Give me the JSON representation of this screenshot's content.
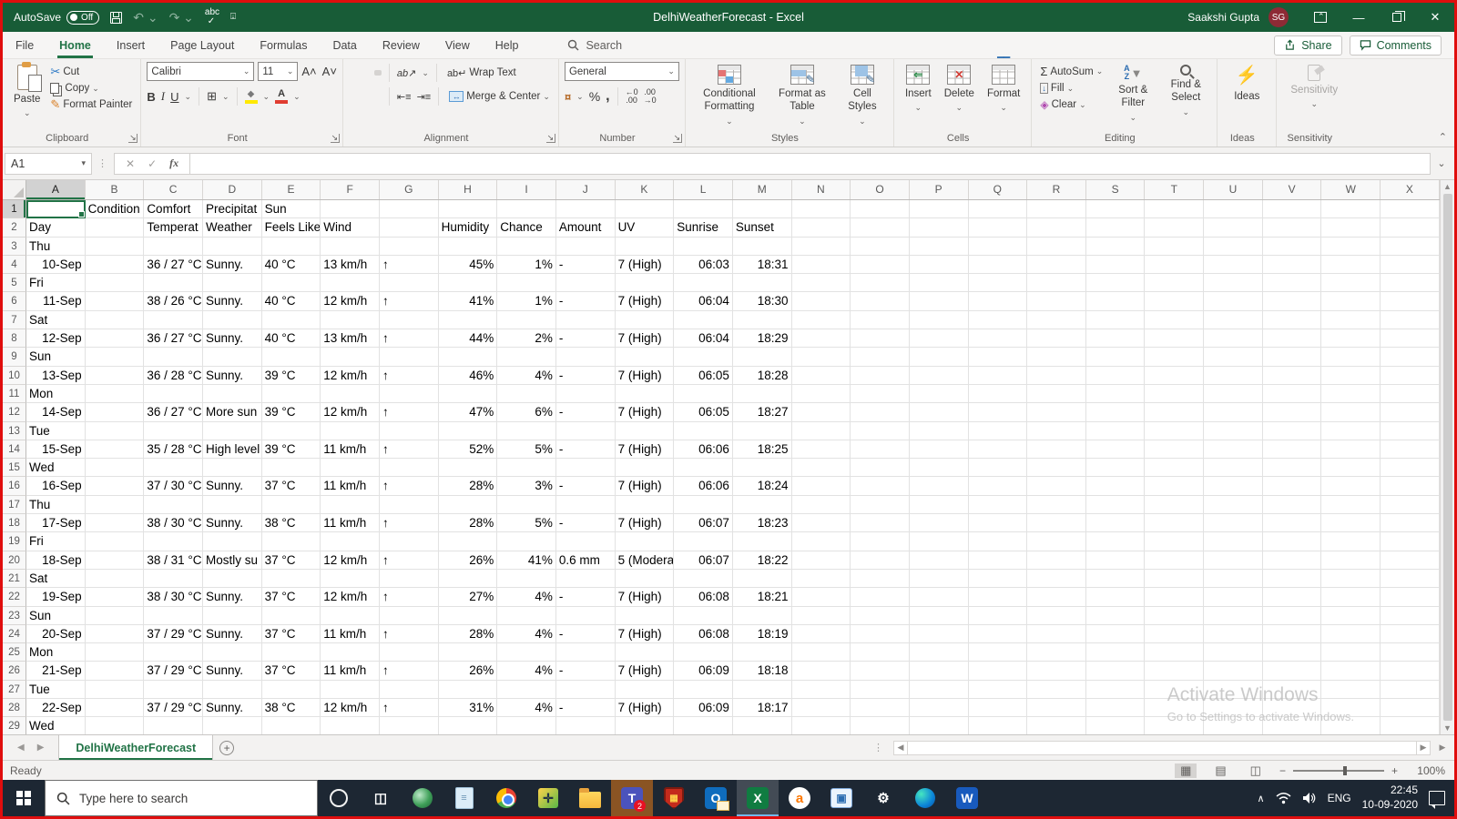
{
  "window": {
    "autosave_label": "AutoSave",
    "autosave_state": "Off",
    "title": "DelhiWeatherForecast  -  Excel",
    "user_name": "Saakshi Gupta",
    "user_initials": "SG"
  },
  "colors": {
    "title_green": "#185c37",
    "accent_green": "#217346",
    "screen_border_red": "#e00d0d",
    "taskbar_dark": "#1d2733",
    "teams_attention_orange": "#8a5423"
  },
  "ribbon_tabs": {
    "items": [
      {
        "label": "File",
        "active": false
      },
      {
        "label": "Home",
        "active": true
      },
      {
        "label": "Insert",
        "active": false
      },
      {
        "label": "Page Layout",
        "active": false
      },
      {
        "label": "Formulas",
        "active": false
      },
      {
        "label": "Data",
        "active": false
      },
      {
        "label": "Review",
        "active": false
      },
      {
        "label": "View",
        "active": false
      },
      {
        "label": "Help",
        "active": false
      }
    ],
    "search_label": "Search",
    "share_label": "Share",
    "comments_label": "Comments"
  },
  "ribbon": {
    "clipboard": {
      "label": "Clipboard",
      "paste": "Paste",
      "cut": "Cut",
      "copy": "Copy",
      "format_painter": "Format Painter"
    },
    "font": {
      "label": "Font",
      "font_name": "Calibri",
      "font_size": "11",
      "bold": "B",
      "italic": "I",
      "underline": "U"
    },
    "alignment": {
      "label": "Alignment",
      "wrap_text": "Wrap Text",
      "merge_center": "Merge & Center"
    },
    "number": {
      "label": "Number",
      "format": "General"
    },
    "styles": {
      "label": "Styles",
      "conditional": "Conditional Formatting",
      "format_table": "Format as Table",
      "cell_styles": "Cell Styles"
    },
    "cells": {
      "label": "Cells",
      "insert": "Insert",
      "delete": "Delete",
      "format": "Format"
    },
    "editing": {
      "label": "Editing",
      "autosum": "AutoSum",
      "fill": "Fill",
      "clear": "Clear",
      "sort_filter": "Sort & Filter",
      "find_select": "Find & Select"
    },
    "ideas": {
      "label": "Ideas",
      "button": "Ideas"
    },
    "sensitivity": {
      "label": "Sensitivity",
      "button": "Sensitivity"
    }
  },
  "formula_bar": {
    "name_box": "A1",
    "fx_label": "fx",
    "formula": ""
  },
  "grid": {
    "selected_cell": "A1",
    "selected_col": "A",
    "selected_row": 1,
    "columns": [
      "A",
      "B",
      "C",
      "D",
      "E",
      "F",
      "G",
      "H",
      "I",
      "J",
      "K",
      "L",
      "M",
      "N",
      "O",
      "P",
      "Q",
      "R",
      "S",
      "T",
      "U",
      "V",
      "W",
      "X"
    ],
    "rows": [
      {
        "n": 1,
        "cells": {
          "B": [
            "Condition"
          ],
          "C": [
            "Comfort"
          ],
          "D": [
            "Precipitat"
          ],
          "E": [
            "Sun"
          ]
        }
      },
      {
        "n": 2,
        "cells": {
          "A": [
            "Day"
          ],
          "C": [
            "Temperat"
          ],
          "D": [
            "Weather"
          ],
          "E": [
            "Feels Like"
          ],
          "F": [
            "Wind"
          ],
          "H": [
            "Humidity"
          ],
          "I": [
            "Chance"
          ],
          "J": [
            "Amount"
          ],
          "K": [
            "UV"
          ],
          "L": [
            "Sunrise"
          ],
          "M": [
            "Sunset"
          ]
        }
      },
      {
        "n": 3,
        "cells": {
          "A": [
            "Thu"
          ]
        }
      },
      {
        "n": 4,
        "cells": {
          "A": [
            "10-Sep",
            "r"
          ],
          "C": [
            "36 / 27 °C"
          ],
          "D": [
            "Sunny."
          ],
          "E": [
            "40 °C"
          ],
          "F": [
            "13 km/h"
          ],
          "G": [
            "↑"
          ],
          "H": [
            "45%",
            "r"
          ],
          "I": [
            "1%",
            "r"
          ],
          "J": [
            "-"
          ],
          "K": [
            "7 (High)"
          ],
          "L": [
            "06:03",
            "r"
          ],
          "M": [
            "18:31",
            "r"
          ]
        }
      },
      {
        "n": 5,
        "cells": {
          "A": [
            "Fri"
          ]
        }
      },
      {
        "n": 6,
        "cells": {
          "A": [
            "11-Sep",
            "r"
          ],
          "C": [
            "38 / 26 °C"
          ],
          "D": [
            "Sunny."
          ],
          "E": [
            "40 °C"
          ],
          "F": [
            "12 km/h"
          ],
          "G": [
            "↑"
          ],
          "H": [
            "41%",
            "r"
          ],
          "I": [
            "1%",
            "r"
          ],
          "J": [
            "-"
          ],
          "K": [
            "7 (High)"
          ],
          "L": [
            "06:04",
            "r"
          ],
          "M": [
            "18:30",
            "r"
          ]
        }
      },
      {
        "n": 7,
        "cells": {
          "A": [
            "Sat"
          ]
        }
      },
      {
        "n": 8,
        "cells": {
          "A": [
            "12-Sep",
            "r"
          ],
          "C": [
            "36 / 27 °C"
          ],
          "D": [
            "Sunny."
          ],
          "E": [
            "40 °C"
          ],
          "F": [
            "13 km/h"
          ],
          "G": [
            "↑"
          ],
          "H": [
            "44%",
            "r"
          ],
          "I": [
            "2%",
            "r"
          ],
          "J": [
            "-"
          ],
          "K": [
            "7 (High)"
          ],
          "L": [
            "06:04",
            "r"
          ],
          "M": [
            "18:29",
            "r"
          ]
        }
      },
      {
        "n": 9,
        "cells": {
          "A": [
            "Sun"
          ]
        }
      },
      {
        "n": 10,
        "cells": {
          "A": [
            "13-Sep",
            "r"
          ],
          "C": [
            "36 / 28 °C"
          ],
          "D": [
            "Sunny."
          ],
          "E": [
            "39 °C"
          ],
          "F": [
            "12 km/h"
          ],
          "G": [
            "↑"
          ],
          "H": [
            "46%",
            "r"
          ],
          "I": [
            "4%",
            "r"
          ],
          "J": [
            "-"
          ],
          "K": [
            "7 (High)"
          ],
          "L": [
            "06:05",
            "r"
          ],
          "M": [
            "18:28",
            "r"
          ]
        }
      },
      {
        "n": 11,
        "cells": {
          "A": [
            "Mon"
          ]
        }
      },
      {
        "n": 12,
        "cells": {
          "A": [
            "14-Sep",
            "r"
          ],
          "C": [
            "36 / 27 °C"
          ],
          "D": [
            "More sun"
          ],
          "E": [
            "39 °C"
          ],
          "F": [
            "12 km/h"
          ],
          "G": [
            "↑"
          ],
          "H": [
            "47%",
            "r"
          ],
          "I": [
            "6%",
            "r"
          ],
          "J": [
            "-"
          ],
          "K": [
            "7 (High)"
          ],
          "L": [
            "06:05",
            "r"
          ],
          "M": [
            "18:27",
            "r"
          ]
        }
      },
      {
        "n": 13,
        "cells": {
          "A": [
            "Tue"
          ]
        }
      },
      {
        "n": 14,
        "cells": {
          "A": [
            "15-Sep",
            "r"
          ],
          "C": [
            "35 / 28 °C"
          ],
          "D": [
            "High level"
          ],
          "E": [
            "39 °C"
          ],
          "F": [
            "11 km/h"
          ],
          "G": [
            "↑"
          ],
          "H": [
            "52%",
            "r"
          ],
          "I": [
            "5%",
            "r"
          ],
          "J": [
            "-"
          ],
          "K": [
            "7 (High)"
          ],
          "L": [
            "06:06",
            "r"
          ],
          "M": [
            "18:25",
            "r"
          ]
        }
      },
      {
        "n": 15,
        "cells": {
          "A": [
            "Wed"
          ]
        }
      },
      {
        "n": 16,
        "cells": {
          "A": [
            "16-Sep",
            "r"
          ],
          "C": [
            "37 / 30 °C"
          ],
          "D": [
            "Sunny."
          ],
          "E": [
            "37 °C"
          ],
          "F": [
            "11 km/h"
          ],
          "G": [
            "↑"
          ],
          "H": [
            "28%",
            "r"
          ],
          "I": [
            "3%",
            "r"
          ],
          "J": [
            "-"
          ],
          "K": [
            "7 (High)"
          ],
          "L": [
            "06:06",
            "r"
          ],
          "M": [
            "18:24",
            "r"
          ]
        }
      },
      {
        "n": 17,
        "cells": {
          "A": [
            "Thu"
          ]
        }
      },
      {
        "n": 18,
        "cells": {
          "A": [
            "17-Sep",
            "r"
          ],
          "C": [
            "38 / 30 °C"
          ],
          "D": [
            "Sunny."
          ],
          "E": [
            "38 °C"
          ],
          "F": [
            "11 km/h"
          ],
          "G": [
            "↑"
          ],
          "H": [
            "28%",
            "r"
          ],
          "I": [
            "5%",
            "r"
          ],
          "J": [
            "-"
          ],
          "K": [
            "7 (High)"
          ],
          "L": [
            "06:07",
            "r"
          ],
          "M": [
            "18:23",
            "r"
          ]
        }
      },
      {
        "n": 19,
        "cells": {
          "A": [
            "Fri"
          ]
        }
      },
      {
        "n": 20,
        "cells": {
          "A": [
            "18-Sep",
            "r"
          ],
          "C": [
            "38 / 31 °C"
          ],
          "D": [
            "Mostly su"
          ],
          "E": [
            "37 °C"
          ],
          "F": [
            "12 km/h"
          ],
          "G": [
            "↑"
          ],
          "H": [
            "26%",
            "r"
          ],
          "I": [
            "41%",
            "r"
          ],
          "J": [
            "0.6 mm"
          ],
          "K": [
            "5 (Modera"
          ],
          "L": [
            "06:07",
            "r"
          ],
          "M": [
            "18:22",
            "r"
          ]
        }
      },
      {
        "n": 21,
        "cells": {
          "A": [
            "Sat"
          ]
        }
      },
      {
        "n": 22,
        "cells": {
          "A": [
            "19-Sep",
            "r"
          ],
          "C": [
            "38 / 30 °C"
          ],
          "D": [
            "Sunny."
          ],
          "E": [
            "37 °C"
          ],
          "F": [
            "12 km/h"
          ],
          "G": [
            "↑"
          ],
          "H": [
            "27%",
            "r"
          ],
          "I": [
            "4%",
            "r"
          ],
          "J": [
            "-"
          ],
          "K": [
            "7 (High)"
          ],
          "L": [
            "06:08",
            "r"
          ],
          "M": [
            "18:21",
            "r"
          ]
        }
      },
      {
        "n": 23,
        "cells": {
          "A": [
            "Sun"
          ]
        }
      },
      {
        "n": 24,
        "cells": {
          "A": [
            "20-Sep",
            "r"
          ],
          "C": [
            "37 / 29 °C"
          ],
          "D": [
            "Sunny."
          ],
          "E": [
            "37 °C"
          ],
          "F": [
            "11 km/h"
          ],
          "G": [
            "↑"
          ],
          "H": [
            "28%",
            "r"
          ],
          "I": [
            "4%",
            "r"
          ],
          "J": [
            "-"
          ],
          "K": [
            "7 (High)"
          ],
          "L": [
            "06:08",
            "r"
          ],
          "M": [
            "18:19",
            "r"
          ]
        }
      },
      {
        "n": 25,
        "cells": {
          "A": [
            "Mon"
          ]
        }
      },
      {
        "n": 26,
        "cells": {
          "A": [
            "21-Sep",
            "r"
          ],
          "C": [
            "37 / 29 °C"
          ],
          "D": [
            "Sunny."
          ],
          "E": [
            "37 °C"
          ],
          "F": [
            "11 km/h"
          ],
          "G": [
            "↑"
          ],
          "H": [
            "26%",
            "r"
          ],
          "I": [
            "4%",
            "r"
          ],
          "J": [
            "-"
          ],
          "K": [
            "7 (High)"
          ],
          "L": [
            "06:09",
            "r"
          ],
          "M": [
            "18:18",
            "r"
          ]
        }
      },
      {
        "n": 27,
        "cells": {
          "A": [
            "Tue"
          ]
        }
      },
      {
        "n": 28,
        "cells": {
          "A": [
            "22-Sep",
            "r"
          ],
          "C": [
            "37 / 29 °C"
          ],
          "D": [
            "Sunny."
          ],
          "E": [
            "38 °C"
          ],
          "F": [
            "12 km/h"
          ],
          "G": [
            "↑"
          ],
          "H": [
            "31%",
            "r"
          ],
          "I": [
            "4%",
            "r"
          ],
          "J": [
            "-"
          ],
          "K": [
            "7 (High)"
          ],
          "L": [
            "06:09",
            "r"
          ],
          "M": [
            "18:17",
            "r"
          ]
        }
      },
      {
        "n": 29,
        "cells": {
          "A": [
            "Wed"
          ]
        }
      }
    ]
  },
  "sheet_tabs": {
    "active_tab": "DelhiWeatherForecast"
  },
  "status_bar": {
    "status": "Ready",
    "zoom": "100%"
  },
  "watermark": {
    "line1": "Activate Windows",
    "line2": "Go to Settings to activate Windows."
  },
  "taskbar": {
    "search_placeholder": "Type here to search",
    "language": "ENG",
    "time": "22:45",
    "date": "10-09-2020",
    "icons": [
      {
        "name": "cortana-icon",
        "shape": "ring",
        "glyph": ""
      },
      {
        "name": "task-view-icon",
        "shape": "glyph",
        "glyph": "◫"
      },
      {
        "name": "cisco-anyconnect-icon",
        "shape": "disc-teal",
        "glyph": ""
      },
      {
        "name": "notepad-icon",
        "shape": "note",
        "glyph": "≡"
      },
      {
        "name": "chrome-icon",
        "shape": "chrome",
        "glyph": ""
      },
      {
        "name": "system-tools-icon",
        "shape": "tools",
        "glyph": "✛"
      },
      {
        "name": "file-explorer-icon",
        "shape": "folder",
        "glyph": ""
      },
      {
        "name": "teams-icon",
        "shape": "teams",
        "glyph": "T",
        "badge": "2",
        "attention": true
      },
      {
        "name": "security-shield-icon",
        "shape": "shield",
        "glyph": "▦"
      },
      {
        "name": "outlook-icon",
        "shape": "outlook",
        "glyph": "O"
      },
      {
        "name": "excel-icon",
        "shape": "excel",
        "glyph": "X",
        "active": true
      },
      {
        "name": "antivirus-icon",
        "shape": "avast",
        "glyph": "a"
      },
      {
        "name": "photos-icon",
        "shape": "photos",
        "glyph": "▣"
      },
      {
        "name": "settings-icon",
        "shape": "glyph",
        "glyph": "⚙"
      },
      {
        "name": "edge-icon",
        "shape": "edge",
        "glyph": ""
      },
      {
        "name": "word-icon",
        "shape": "word",
        "glyph": "W"
      }
    ]
  }
}
